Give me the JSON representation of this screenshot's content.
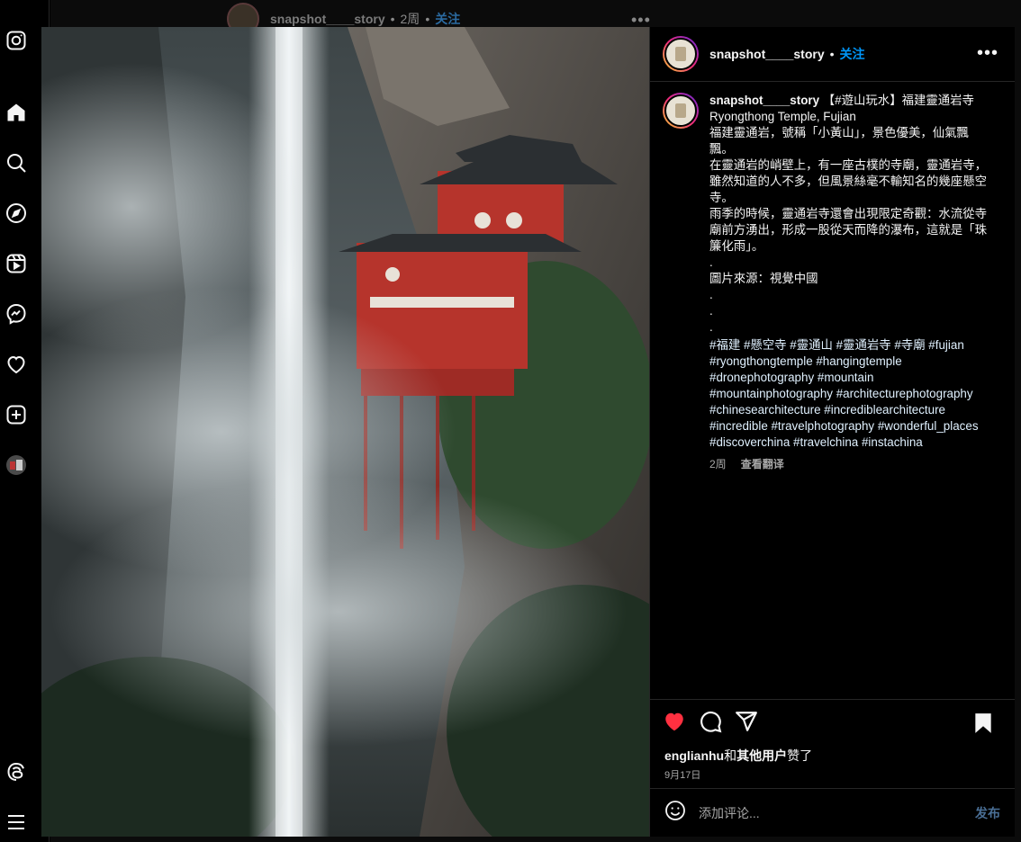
{
  "background_post": {
    "username": "snapshot____story",
    "time": "2周",
    "follow_label": "关注",
    "separator": "•"
  },
  "post": {
    "username": "snapshot____story",
    "separator": "•",
    "follow_label": "关注",
    "caption_lines": [
      "【#遊山玩水】福建靈通岩寺",
      "Ryongthong Temple, Fujian",
      "福建靈通岩，號稱「小黃山」，景色優美，仙氣飄飄。",
      "在靈通岩的峭壁上，有一座古樸的寺廟，靈通岩寺，雖然知道的人不多，但風景絲毫不輸知名的幾座懸空寺。",
      "雨季的時候，靈通岩寺還會出現限定奇觀：水流從寺廟前方湧出，形成一股從天而降的瀑布，這就是「珠簾化雨」。",
      ".",
      "圖片來源：視覺中國",
      ".",
      ".",
      "."
    ],
    "hashtags": "#福建 #懸空寺 #靈通山 #靈通岩寺 #寺廟 #fujian #ryongthongtemple #hangingtemple #dronephotography #mountain #mountainphotography #architecturephotography #chinesearchitecture #incrediblearchitecture #incredible #travelphotography #wonderful_places #discoverchina #travelchina #instachina",
    "time": "2周",
    "translate_label": "查看翻译",
    "liked_by_user": "englianhu",
    "liked_connector": "和",
    "liked_others": "其他用户",
    "liked_suffix": "赞了",
    "date": "9月17日",
    "comment_placeholder": "添加评论...",
    "post_label": "发布",
    "more_label": "•••"
  },
  "icons": [
    "instagram-icon",
    "home-icon",
    "search-icon",
    "explore-icon",
    "reels-icon",
    "messenger-icon",
    "heart-icon",
    "create-icon",
    "profile-avatar",
    "threads-icon",
    "menu-icon"
  ],
  "colors": {
    "accent": "#0095f6",
    "like": "#ff3040",
    "background": "#000000",
    "border": "#262626"
  }
}
